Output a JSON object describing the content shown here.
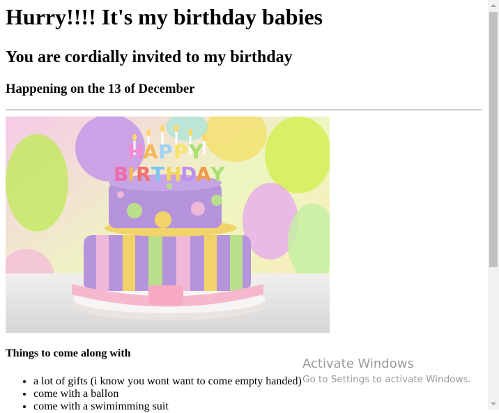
{
  "page": {
    "title": "Hurry!!!! It's my birthday babies",
    "subtitle": "You are cordially invited to my birthday",
    "date_line": "Happening on the 13 of December",
    "photo": {
      "cake_text": "HAPPY BIRTHDAY"
    },
    "list_heading": "Things to come along with",
    "items": [
      "a lot of gifts (i know you wont want to come empty handed)",
      "come with a ballon",
      "come with a swimimming suit"
    ]
  },
  "watermark": {
    "title": "Activate Windows",
    "subtitle": "Go to Settings to activate Windows."
  },
  "colors": {
    "background": "#ffffff",
    "text": "#000000",
    "rule": "#9a9a9a",
    "scrollbar_track": "#f1f1f1",
    "scrollbar_thumb": "#c1c1c1"
  }
}
